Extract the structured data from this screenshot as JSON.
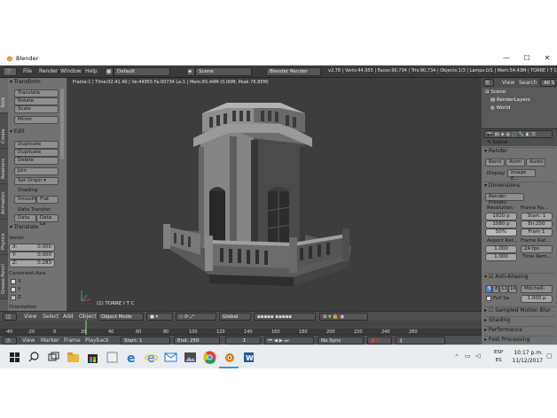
{
  "window": {
    "title": "Blender",
    "min": "—",
    "max": "☐",
    "close": "✕"
  },
  "infobar": {
    "menu": [
      "File",
      "Render",
      "Window",
      "Help"
    ],
    "layout": "Default",
    "scene": "Scene",
    "engine": "Blender Render",
    "stats": "v2.78 | Verts:44,955 | Faces:90,734 | Tris:90,734 | Objects:1/3 | Lamps:0/1 | Mem:54.43M | TORRE I T C"
  },
  "viewport": {
    "info": "Frame:1 | Time:02:41.40 | Ve:44955 Fa:90734 La:1 | Mem:65.44M (0.00M, Peak 76.85M)",
    "object_name": "(1) TORRE I T C"
  },
  "toolshelf": {
    "tabs": [
      "Tools",
      "Create",
      "Relations",
      "Animation",
      "Physics",
      "Grease Pencil"
    ],
    "transform_header": "Transform",
    "transform_buttons": [
      "Translate",
      "Rotate",
      "Scale",
      "Mirror"
    ],
    "edit_header": "Edit",
    "edit_buttons": [
      "Duplicate",
      "Duplicate Linked",
      "Delete",
      "Join"
    ],
    "set_origin": "Set Origin",
    "shading_label": "Shading",
    "smooth": "Smooth",
    "flat": "Flat",
    "data_transfer_label": "Data Transfer",
    "data": "Data",
    "data_la": "Data La",
    "translate_header": "Translate",
    "vector_label": "Vector",
    "vector": [
      {
        "axis": "X:",
        "value": "0.000"
      },
      {
        "axis": "Y:",
        "value": "0.000"
      },
      {
        "axis": "Z:",
        "value": "0.283"
      }
    ],
    "constraint_label": "Constraint Axis",
    "constraint": [
      {
        "axis": "X",
        "checked": false
      },
      {
        "axis": "Y",
        "checked": false
      },
      {
        "axis": "Z",
        "checked": true
      }
    ],
    "orientation_label": "Orientation"
  },
  "view3d_header": {
    "menu": [
      "View",
      "Select",
      "Add",
      "Object"
    ],
    "mode": "Object Mode",
    "pivot": "Global"
  },
  "timeline": {
    "ticks": [
      "-40",
      "-20",
      "0",
      "20",
      "40",
      "60",
      "80",
      "100",
      "120",
      "140",
      "160",
      "180",
      "200",
      "220",
      "240",
      "260"
    ],
    "menu": [
      "View",
      "Marker",
      "Frame",
      "Playback"
    ],
    "start": "Start:",
    "start_value": "1",
    "end": "End:",
    "end_value": "250",
    "current": "1",
    "sync": "No Sync"
  },
  "outliner": {
    "header_items": [
      "View",
      "Search",
      "All S"
    ],
    "rows": [
      "Scene",
      "RenderLayers",
      "World"
    ]
  },
  "properties": {
    "context": "Scene",
    "render_header": "Render",
    "render_buttons": [
      "Rend",
      "Anim",
      "Audio"
    ],
    "display_label": "Display",
    "display_value": "Image E...",
    "dimensions_header": "Dimensions",
    "render_presets": "Render Presets",
    "resolution_label": "Resolution:",
    "res_x": "1920 p",
    "res_y": "1080 p",
    "res_pct": "50%",
    "frame_range_label": "Frame Ra...",
    "frame_start": "Start: 1",
    "frame_end": "En:250",
    "frame_step": "Fram 1",
    "aspect_label": "Aspect Rat...",
    "aspect_x": "1.000",
    "aspect_y": "1.000",
    "frame_rate_label": "Frame Rat...",
    "frame_rate": "24 fps",
    "time_rem_label": "Time Rem...",
    "aa_header": "Anti-Aliasing",
    "aa_values": [
      "5",
      "8",
      "11",
      "16"
    ],
    "aa_filter": "Mitchell-",
    "full_sample": "Full Sa",
    "aa_size": "1.000 p",
    "motion_blur": "Sampled Motion Blur",
    "shading": "Shading",
    "performance": "Performance",
    "post_processing": "Post Processing"
  },
  "taskbar": {
    "lang": "ESP",
    "lang2": "ES",
    "time": "10:17 p.m.",
    "date": "11/12/2017"
  }
}
